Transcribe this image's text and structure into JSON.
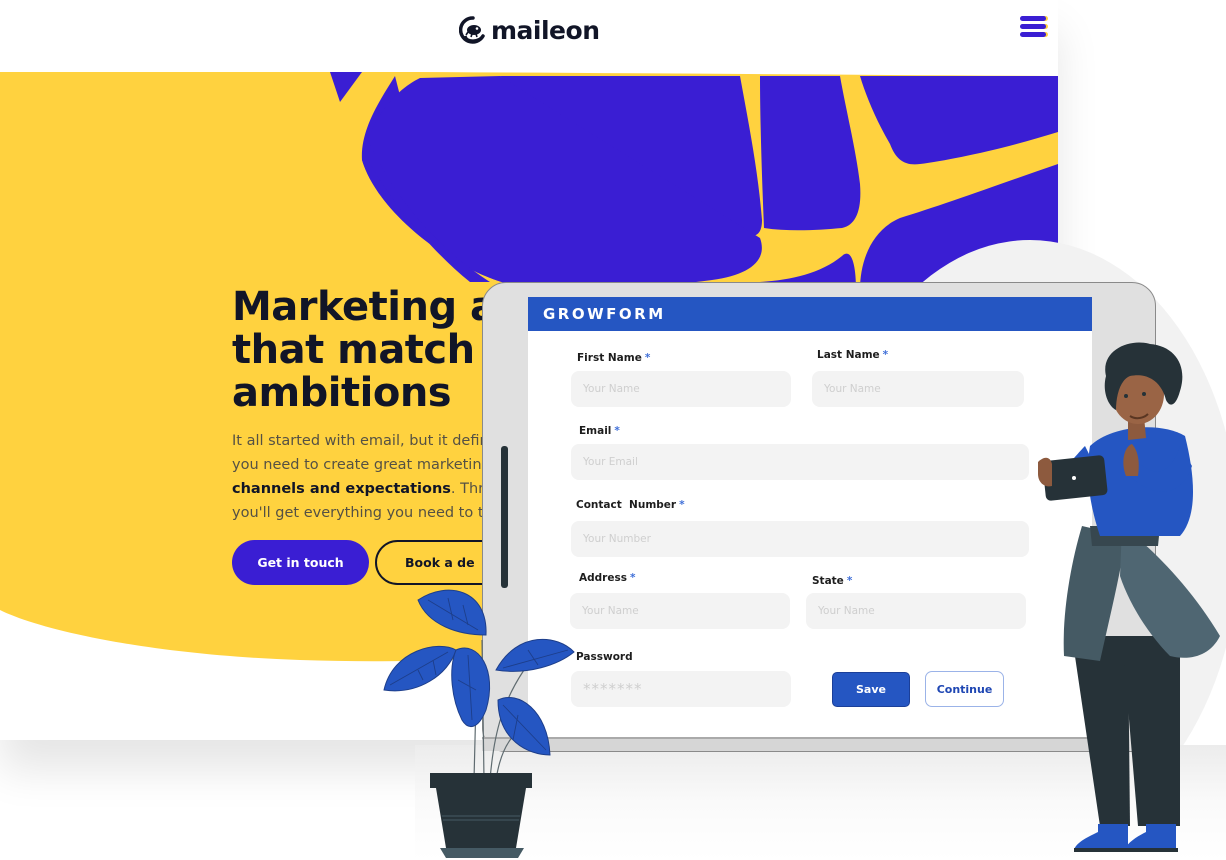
{
  "site": {
    "logo_text": "maileon",
    "menu_icon": "hamburger-menu-icon",
    "hero": {
      "headline": "Marketing a\nthat match\nambitions",
      "lead_line1": "It all started with email, but it definit",
      "lead_line2": "you need to create great marketing",
      "lead_bold": "channels and expectations",
      "lead_line3_rest": ". Thro",
      "lead_line4": "you'll get everything you need to t",
      "primary_button": "Get in touch",
      "secondary_button": "Book a de"
    },
    "colors": {
      "yellow": "#ffd23f",
      "indigo": "#3a1ed3",
      "ink": "#111527"
    }
  },
  "form": {
    "title": "GROWFORM",
    "required_marker": "*",
    "fields": {
      "first_name": {
        "label": "First Name",
        "placeholder": "Your Name",
        "value": ""
      },
      "last_name": {
        "label": "Last Name",
        "placeholder": "Your Name",
        "value": ""
      },
      "email": {
        "label": "Email",
        "placeholder": "Your Email",
        "value": ""
      },
      "contact_number": {
        "label": "Contact  Number",
        "placeholder": "Your Number",
        "value": ""
      },
      "address": {
        "label": "Address",
        "placeholder": "Your Name",
        "value": ""
      },
      "state": {
        "label": "State",
        "placeholder": "Your Name",
        "value": ""
      },
      "password": {
        "label": "Password",
        "placeholder": "*******",
        "value": ""
      }
    },
    "save_label": "Save",
    "continue_label": "Continue",
    "colors": {
      "header": "#2556c2",
      "required": "#3f6fd8"
    }
  }
}
